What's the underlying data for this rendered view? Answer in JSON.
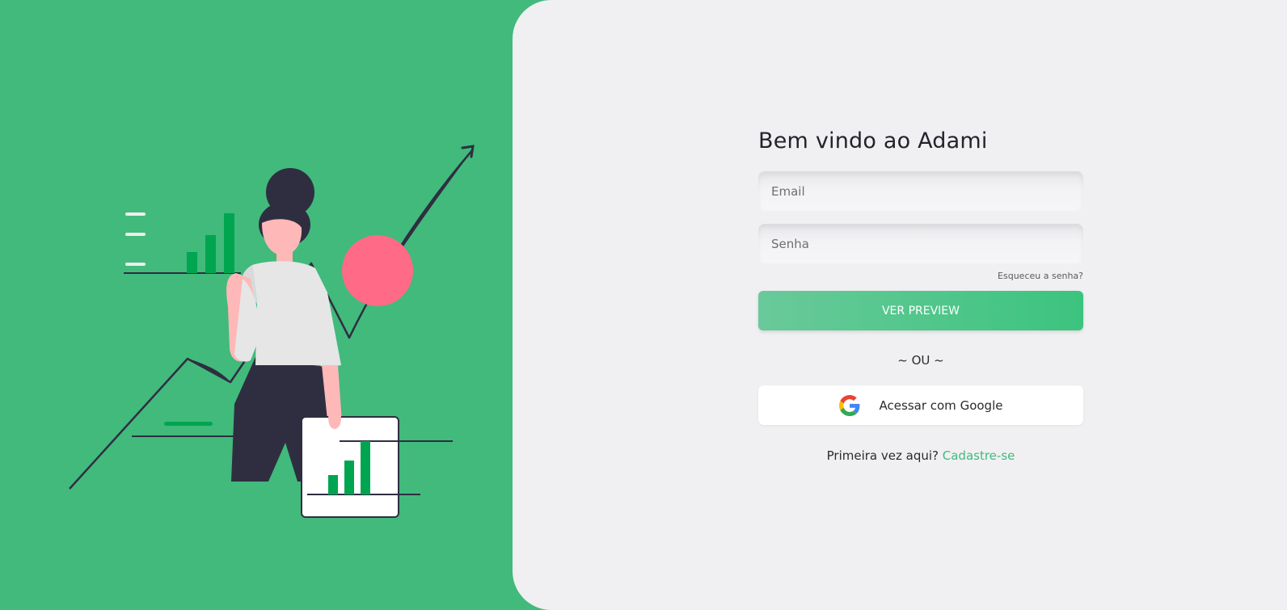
{
  "colors": {
    "brand_green": "#41ba7c",
    "panel_bg": "#f0f0f2",
    "accent_pink": "#ff6b86",
    "dark_navy": "#2f2e41",
    "bar_green": "#00a550"
  },
  "login": {
    "title": "Bem vindo ao Adami",
    "email_placeholder": "Email",
    "password_placeholder": "Senha",
    "forgot_password": "Esqueceu a senha?",
    "preview_button": "VER PREVIEW",
    "divider": "~ OU ~",
    "google_button": "Acessar com Google",
    "google_icon": "google-g-logo-icon",
    "first_time_text": "Primeira vez aqui?",
    "signup_link": "Cadastre-se"
  },
  "illustration": {
    "subject": "woman presenting growth charts",
    "icons": [
      "growth-arrow-icon",
      "bar-chart-icon",
      "pink-circle-icon"
    ]
  }
}
